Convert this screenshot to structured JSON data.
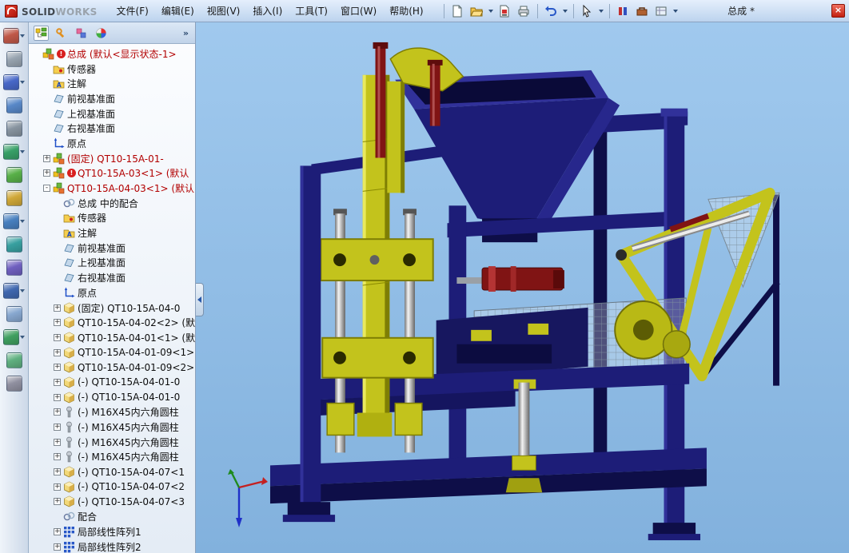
{
  "window": {
    "brand_bold": "SOLID",
    "brand_light": "WORKS",
    "doc_title": "总成 *",
    "close_glyph": "×"
  },
  "menubar": {
    "items": [
      {
        "id": "file",
        "label": "文件(F)"
      },
      {
        "id": "edit",
        "label": "编辑(E)"
      },
      {
        "id": "view",
        "label": "视图(V)"
      },
      {
        "id": "insert",
        "label": "插入(I)"
      },
      {
        "id": "tools",
        "label": "工具(T)"
      },
      {
        "id": "window",
        "label": "窗口(W)"
      },
      {
        "id": "help",
        "label": "帮助(H)"
      }
    ]
  },
  "toolbar": {
    "items": [
      {
        "id": "sep",
        "sep": true
      },
      {
        "id": "new-document"
      },
      {
        "id": "open",
        "arrow": true
      },
      {
        "id": "print-preview"
      },
      {
        "id": "print"
      },
      {
        "id": "sep",
        "sep": true
      },
      {
        "id": "undo",
        "arrow": true
      },
      {
        "id": "sep",
        "sep": true
      },
      {
        "id": "select",
        "arrow": true
      },
      {
        "id": "sep",
        "sep": true
      },
      {
        "id": "color-bars"
      },
      {
        "id": "toolbox"
      },
      {
        "id": "view-settings",
        "arrow": true
      }
    ]
  },
  "left_toolbar": {
    "items": [
      {
        "id": "left-tool-1",
        "tint": "#c05848",
        "arrow": true
      },
      {
        "id": "left-tool-2",
        "tint": "#98a4b0",
        "arrow": false
      },
      {
        "id": "left-tool-3",
        "tint": "#4868c8",
        "arrow": true
      },
      {
        "id": "left-tool-4",
        "tint": "#5888c8",
        "arrow": false
      },
      {
        "id": "left-tool-5",
        "tint": "#8894a0",
        "arrow": false
      },
      {
        "id": "left-tool-6",
        "tint": "#38a068",
        "arrow": true
      },
      {
        "id": "left-tool-7",
        "tint": "#58b048",
        "arrow": false
      },
      {
        "id": "left-tool-8",
        "tint": "#d0a838",
        "arrow": false
      },
      {
        "id": "left-tool-9",
        "tint": "#4880c0",
        "arrow": true
      },
      {
        "id": "left-tool-10",
        "tint": "#38a0a0",
        "arrow": false
      },
      {
        "id": "left-tool-11",
        "tint": "#7060c0",
        "arrow": false
      },
      {
        "id": "left-tool-12",
        "tint": "#4068b0",
        "arrow": true
      },
      {
        "id": "left-tool-13",
        "tint": "#88a8d0",
        "arrow": false
      },
      {
        "id": "left-tool-14",
        "tint": "#40a060",
        "arrow": true
      },
      {
        "id": "left-tool-15",
        "tint": "#60b080",
        "arrow": false
      },
      {
        "id": "left-tool-16",
        "tint": "#9090a0",
        "arrow": false
      }
    ]
  },
  "panel_tabs": {
    "chevron": "»",
    "items": [
      {
        "id": "featuremanager",
        "active": true
      },
      {
        "id": "propertymanager",
        "active": false
      },
      {
        "id": "configurationmanager",
        "active": false
      },
      {
        "id": "displaymanager",
        "active": false
      }
    ]
  },
  "feature_tree": {
    "items": [
      {
        "label": "总成 (默认<显示状态-1>",
        "icon": "assembly",
        "indent": 0,
        "expander": "none",
        "red": true,
        "badge": true
      },
      {
        "label": "传感器",
        "icon": "sensors",
        "indent": 1,
        "expander": "none"
      },
      {
        "label": "注解",
        "icon": "annotations",
        "indent": 1,
        "expander": "none"
      },
      {
        "label": "前视基准面",
        "icon": "plane",
        "indent": 1,
        "expander": "none"
      },
      {
        "label": "上视基准面",
        "icon": "plane",
        "indent": 1,
        "expander": "none"
      },
      {
        "label": "右视基准面",
        "icon": "plane",
        "indent": 1,
        "expander": "none"
      },
      {
        "label": "原点",
        "icon": "origin",
        "indent": 1,
        "expander": "none"
      },
      {
        "label": "(固定) QT10-15A-01-",
        "icon": "assembly",
        "indent": 1,
        "expander": "plus",
        "red": true
      },
      {
        "label": "QT10-15A-03<1> (默认",
        "icon": "assembly",
        "indent": 1,
        "expander": "plus",
        "red": true,
        "badge": true
      },
      {
        "label": "QT10-15A-04-03<1> (默认",
        "icon": "assembly",
        "indent": 1,
        "expander": "minus",
        "red": true
      },
      {
        "label": "总成 中的配合",
        "icon": "mates",
        "indent": 2,
        "expander": "none"
      },
      {
        "label": "传感器",
        "icon": "sensors",
        "indent": 2,
        "expander": "none"
      },
      {
        "label": "注解",
        "icon": "annotations",
        "indent": 2,
        "expander": "none"
      },
      {
        "label": "前视基准面",
        "icon": "plane",
        "indent": 2,
        "expander": "none"
      },
      {
        "label": "上视基准面",
        "icon": "plane",
        "indent": 2,
        "expander": "none"
      },
      {
        "label": "右视基准面",
        "icon": "plane",
        "indent": 2,
        "expander": "none"
      },
      {
        "label": "原点",
        "icon": "origin",
        "indent": 2,
        "expander": "none"
      },
      {
        "label": "(固定) QT10-15A-04-0",
        "icon": "part",
        "indent": 2,
        "expander": "plus"
      },
      {
        "label": "QT10-15A-04-02<2> (默",
        "icon": "part",
        "indent": 2,
        "expander": "plus"
      },
      {
        "label": "QT10-15A-04-01<1> (默",
        "icon": "part",
        "indent": 2,
        "expander": "plus"
      },
      {
        "label": "QT10-15A-04-01-09<1>",
        "icon": "part",
        "indent": 2,
        "expander": "plus"
      },
      {
        "label": "QT10-15A-04-01-09<2>",
        "icon": "part",
        "indent": 2,
        "expander": "plus"
      },
      {
        "label": "(-) QT10-15A-04-01-0",
        "icon": "part",
        "indent": 2,
        "expander": "plus"
      },
      {
        "label": "(-) QT10-15A-04-01-0",
        "icon": "part",
        "indent": 2,
        "expander": "plus"
      },
      {
        "label": "(-) M16X45内六角圆柱",
        "icon": "fastener",
        "indent": 2,
        "expander": "plus"
      },
      {
        "label": "(-) M16X45内六角圆柱",
        "icon": "fastener",
        "indent": 2,
        "expander": "plus"
      },
      {
        "label": "(-) M16X45内六角圆柱",
        "icon": "fastener",
        "indent": 2,
        "expander": "plus"
      },
      {
        "label": "(-) M16X45内六角圆柱",
        "icon": "fastener",
        "indent": 2,
        "expander": "plus"
      },
      {
        "label": "(-) QT10-15A-04-07<1",
        "icon": "part",
        "indent": 2,
        "expander": "plus"
      },
      {
        "label": "(-) QT10-15A-04-07<2",
        "icon": "part",
        "indent": 2,
        "expander": "plus"
      },
      {
        "label": "(-) QT10-15A-04-07<3",
        "icon": "part",
        "indent": 2,
        "expander": "plus"
      },
      {
        "label": "配合",
        "icon": "mates",
        "indent": 2,
        "expander": "none"
      },
      {
        "label": "局部线性阵列1",
        "icon": "pattern",
        "indent": 2,
        "expander": "plus"
      },
      {
        "label": "局部线性阵列2",
        "icon": "pattern",
        "indent": 2,
        "expander": "plus"
      }
    ]
  },
  "theme": {
    "navy": "#1d1d78",
    "navy_dark": "#0e0e48",
    "navy_light": "#31319a",
    "yellow": "#c3c31c",
    "yellow_dark": "#7e7e04",
    "yellow_light": "#e9e95e",
    "red_dark": "#801414",
    "red_mid": "#b43434",
    "silver": "#cfcfcf",
    "sky_top": "#a0c9ee",
    "sky_bottom": "#82b1dd",
    "error_red": "#d81f1f",
    "tree_red": "#b20000"
  }
}
